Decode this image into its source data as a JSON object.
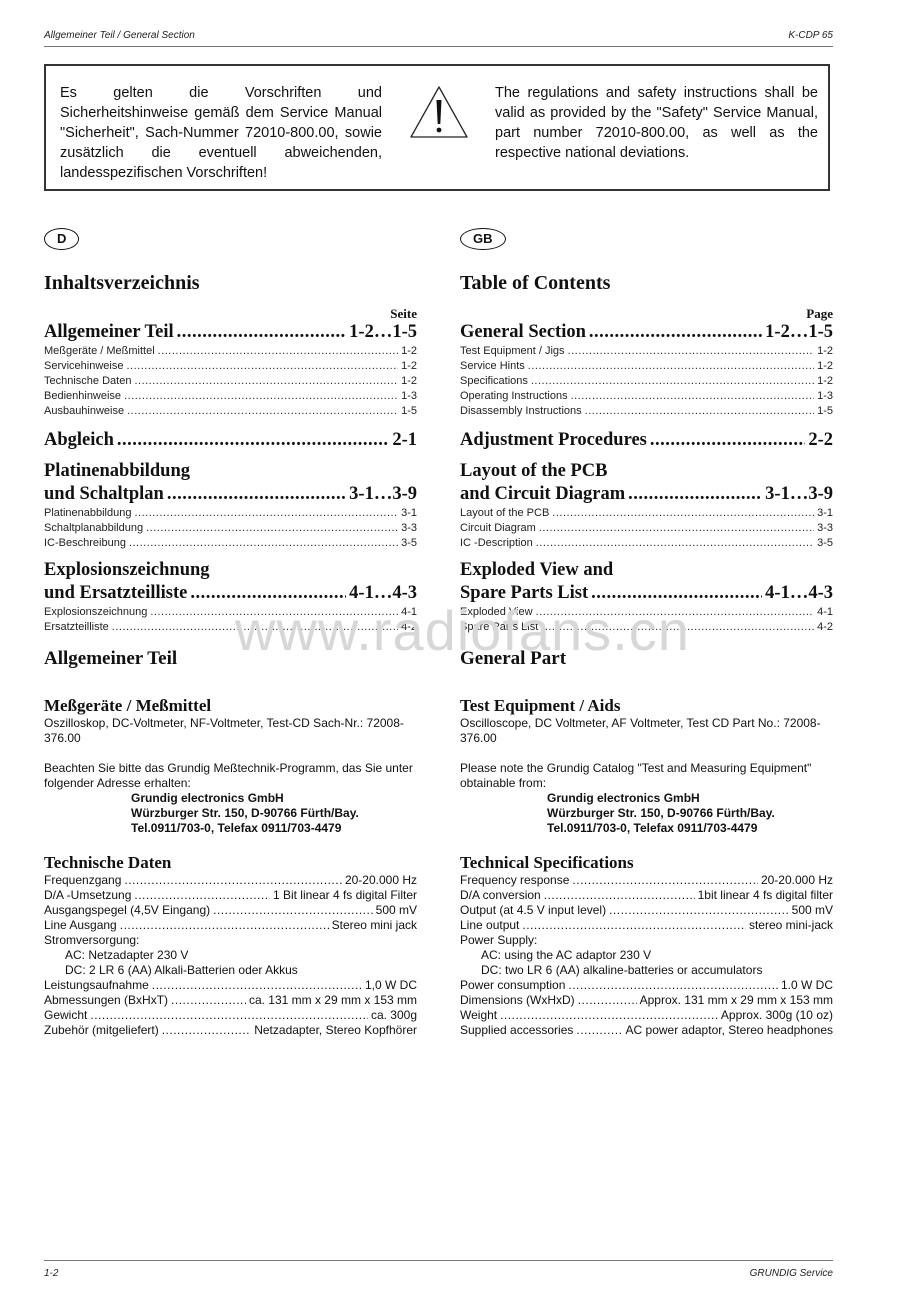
{
  "header": {
    "section": "Allgemeiner Teil / General Section",
    "model": "K-CDP 65"
  },
  "footer": {
    "page": "1-2",
    "brand": "GRUNDIG Service"
  },
  "notice": {
    "german": "Es gelten die Vorschriften und Sicherheitshinweise gemäß dem Service Manual \"Sicherheit\", Sach-Nummer 72010-800.00, sowie zusätzlich die eventuell abweichenden, landesspezifischen Vorschriften!",
    "english": "The regulations and safety instructions shall be valid as provided by the \"Safety\" Service Manual, part number 72010-800.00, as well as the respective national deviations.",
    "icon": "warning-icon"
  },
  "watermark": "www.radiofans.cn",
  "toc": {
    "de": {
      "badge": "D",
      "title": "Inhaltsverzeichnis",
      "page_label": "Seite",
      "sections": [
        {
          "title": "Allgemeiner Teil",
          "pages": "1-2…1-5",
          "items": [
            {
              "label": "Meßgeräte / Meßmittel",
              "page": "1-2"
            },
            {
              "label": "Servicehinweise",
              "page": "1-2"
            },
            {
              "label": "Technische Daten",
              "page": "1-2"
            },
            {
              "label": "Bedienhinweise",
              "page": "1-3"
            },
            {
              "label": "Ausbauhinweise",
              "page": "1-5"
            }
          ]
        },
        {
          "title": "Abgleich",
          "pages": "2-1",
          "items": []
        },
        {
          "title_line1": "Platinenabbildung",
          "title": "und Schaltplan",
          "pages": "3-1…3-9",
          "items": [
            {
              "label": "Platinenabbildung",
              "page": "3-1"
            },
            {
              "label": "Schaltplanabbildung",
              "page": "3-3"
            },
            {
              "label": "IC-Beschreibung",
              "page": "3-5"
            }
          ]
        },
        {
          "title_line1": "Explosionszeichnung",
          "title": "und Ersatzteilliste",
          "pages": "4-1…4-3",
          "items": [
            {
              "label": "Explosionszeichnung",
              "page": "4-1"
            },
            {
              "label": "Ersatzteilliste",
              "page": "4-2"
            }
          ]
        }
      ]
    },
    "en": {
      "badge": "GB",
      "title": "Table of Contents",
      "page_label": "Page",
      "sections": [
        {
          "title": "General Section",
          "pages": "1-2…1-5",
          "items": [
            {
              "label": "Test Equipment / Jigs",
              "page": "1-2"
            },
            {
              "label": "Service Hints",
              "page": "1-2"
            },
            {
              "label": "Specifications",
              "page": "1-2"
            },
            {
              "label": "Operating Instructions",
              "page": "1-3"
            },
            {
              "label": "Disassembly Instructions",
              "page": "1-5"
            }
          ]
        },
        {
          "title": "Adjustment Procedures",
          "pages": "2-2",
          "items": []
        },
        {
          "title_line1": "Layout of the PCB",
          "title": "and Circuit Diagram",
          "pages": "3-1…3-9",
          "items": [
            {
              "label": "Layout of the PCB",
              "page": "3-1"
            },
            {
              "label": "Circuit Diagram",
              "page": "3-3"
            },
            {
              "label": "IC -Description",
              "page": "3-5"
            }
          ]
        },
        {
          "title_line1": "Exploded View and",
          "title": "Spare Parts List",
          "pages": "4-1…4-3",
          "items": [
            {
              "label": "Exploded View",
              "page": "4-1"
            },
            {
              "label": "Spare Parts List",
              "page": "4-2"
            }
          ]
        }
      ]
    }
  },
  "general": {
    "de": {
      "title": "Allgemeiner Teil",
      "equip_title": "Meßgeräte / Meßmittel",
      "equip_text": "Oszilloskop, DC-Voltmeter, NF-Voltmeter, Test-CD Sach-Nr.: 72008-376.00",
      "catalog_text": "Beachten Sie bitte das Grundig Meßtechnik-Programm, das Sie unter folgender Adresse erhalten:",
      "address": [
        "Grundig electronics GmbH",
        "Würzburger Str. 150, D-90766 Fürth/Bay.",
        "Tel.0911/703-0, Telefax 0911/703-4479"
      ],
      "spec_title": "Technische Daten",
      "specs": [
        {
          "label": "Frequenzgang",
          "value": "20-20.000 Hz"
        },
        {
          "label": "D/A -Umsetzung",
          "value": "1 Bit linear 4 fs digital Filter"
        },
        {
          "label": "Ausgangspegel (4,5V Eingang)",
          "value": "500 mV"
        },
        {
          "label": "Line Ausgang",
          "value": "Stereo mini jack"
        }
      ],
      "power_label": "Stromversorgung:",
      "power_lines": [
        "AC: Netzadapter 230 V",
        "DC: 2 LR 6 (AA) Alkali-Batterien oder Akkus"
      ],
      "specs2": [
        {
          "label": "Leistungsaufnahme",
          "value": "1,0 W DC"
        },
        {
          "label": "Abmessungen (BxHxT)",
          "value": "ca. 131 mm x 29 mm x 153 mm"
        },
        {
          "label": "Gewicht",
          "value": "ca. 300g"
        },
        {
          "label": "Zubehör (mitgeliefert)",
          "value": "Netzadapter, Stereo Kopfhörer"
        }
      ]
    },
    "en": {
      "title": "General Part",
      "equip_title": "Test Equipment / Aids",
      "equip_text": "Oscilloscope, DC Voltmeter, AF Voltmeter, Test CD Part No.: 72008-376.00",
      "catalog_text": "Please note the Grundig Catalog \"Test and Measuring Equipment\" obtainable from:",
      "address": [
        "Grundig electronics GmbH",
        "Würzburger Str. 150, D-90766 Fürth/Bay.",
        "Tel.0911/703-0, Telefax 0911/703-4479"
      ],
      "spec_title": "Technical Specifications",
      "specs": [
        {
          "label": "Frequency response",
          "value": "20-20.000 Hz"
        },
        {
          "label": "D/A conversion",
          "value": "1bit linear 4 fs digital filter"
        },
        {
          "label": "Output (at 4.5 V input level)",
          "value": "500 mV"
        },
        {
          "label": "Line output",
          "value": "stereo mini-jack"
        }
      ],
      "power_label": "Power Supply:",
      "power_lines": [
        "AC: using the AC adaptor 230 V",
        "DC: two LR 6 (AA) alkaline-batteries or accumulators"
      ],
      "specs2": [
        {
          "label": "Power consumption",
          "value": "1.0 W DC"
        },
        {
          "label": "Dimensions (WxHxD)",
          "value": "Approx. 131 mm x 29 mm x 153 mm"
        },
        {
          "label": "Weight",
          "value": "Approx.  300g (10 oz)"
        },
        {
          "label": "Supplied accessories",
          "value": "AC power adaptor, Stereo headphones"
        }
      ]
    }
  }
}
